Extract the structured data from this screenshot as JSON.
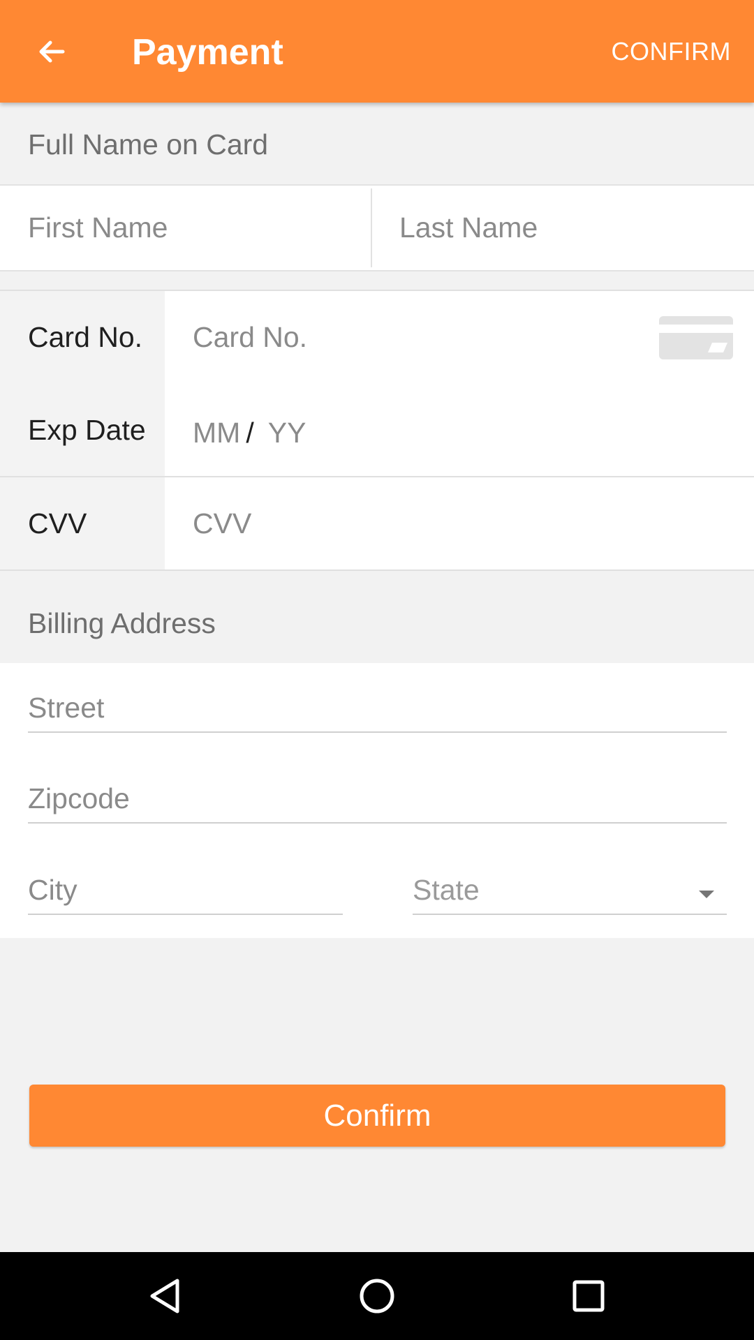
{
  "app_bar": {
    "back_icon": "arrow-back-icon",
    "title": "Payment",
    "action_label": "CONFIRM",
    "color": "#ff8833"
  },
  "name_section": {
    "header": "Full Name on Card",
    "first_name_placeholder": "First Name",
    "last_name_placeholder": "Last Name"
  },
  "card_section": {
    "card_no_label": "Card No.",
    "card_no_placeholder": "Card No.",
    "card_icon": "credit-card-icon",
    "exp_label": "Exp Date",
    "exp_month_placeholder": "MM",
    "exp_separator": "/",
    "exp_year_placeholder": "YY",
    "cvv_label": "CVV",
    "cvv_placeholder": "CVV"
  },
  "billing": {
    "header": "Billing Address",
    "street_placeholder": "Street",
    "zipcode_placeholder": "Zipcode",
    "city_placeholder": "City",
    "state_placeholder": "State",
    "state_icon": "dropdown-arrow-icon"
  },
  "confirm_button": {
    "label": "Confirm",
    "color": "#ff8833"
  },
  "nav_bar": {
    "back_icon": "nav-back-triangle-icon",
    "home_icon": "nav-home-circle-icon",
    "recents_icon": "nav-recents-square-icon"
  }
}
